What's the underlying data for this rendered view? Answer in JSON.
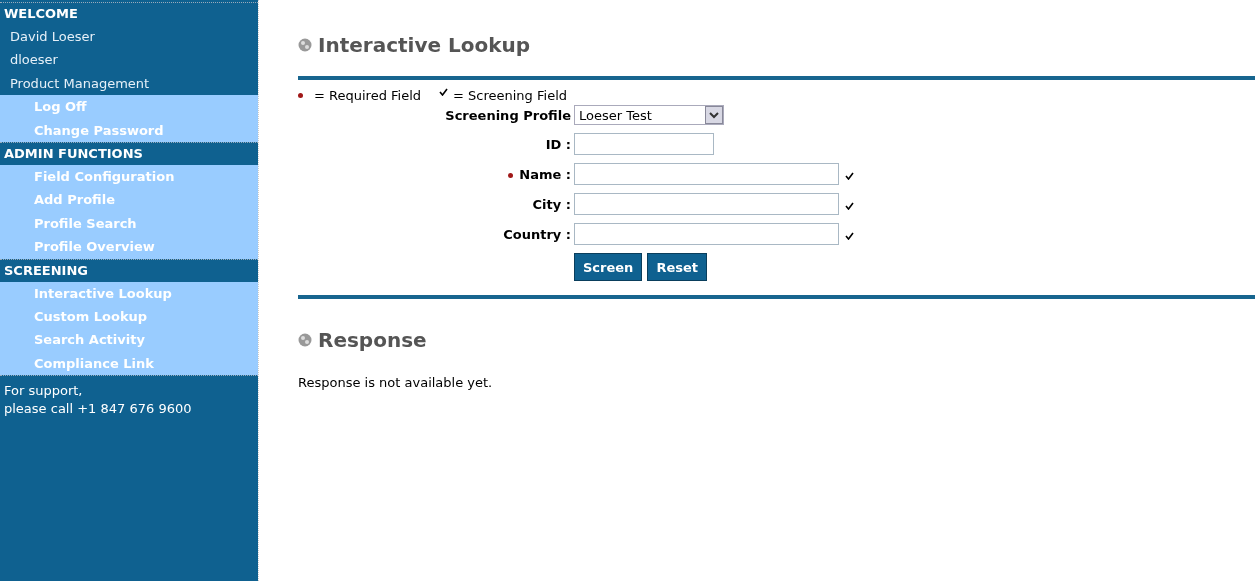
{
  "sidebar": {
    "sections": [
      {
        "heading": "WELCOME",
        "items": [
          {
            "label": "David Loeser",
            "kind": "info"
          },
          {
            "label": "dloeser",
            "kind": "info"
          },
          {
            "label": "Product Management",
            "kind": "info"
          },
          {
            "label": "Log Off",
            "kind": "link"
          },
          {
            "label": "Change Password",
            "kind": "link"
          }
        ]
      },
      {
        "heading": "ADMIN FUNCTIONS",
        "items": [
          {
            "label": "Field Configuration",
            "kind": "link"
          },
          {
            "label": "Add Profile",
            "kind": "link"
          },
          {
            "label": "Profile Search",
            "kind": "link"
          },
          {
            "label": "Profile Overview",
            "kind": "link"
          }
        ]
      },
      {
        "heading": "SCREENING",
        "items": [
          {
            "label": "Interactive Lookup",
            "kind": "link"
          },
          {
            "label": "Custom Lookup",
            "kind": "link"
          },
          {
            "label": "Search Activity",
            "kind": "link"
          },
          {
            "label": "Compliance Link",
            "kind": "link"
          }
        ]
      }
    ],
    "footer": [
      "For support,",
      "please call +1 847 676 9600"
    ]
  },
  "lookup": {
    "title": "Interactive Lookup",
    "legend": {
      "required": "= Required Field",
      "screening": "= Screening Field"
    },
    "profile": {
      "label": "Screening Profile",
      "value": "Loeser Test"
    },
    "fields": [
      {
        "label": "ID :",
        "required": false,
        "screening": false,
        "kind": "short"
      },
      {
        "label": "Name :",
        "required": true,
        "screening": true,
        "kind": "long"
      },
      {
        "label": "City :",
        "required": false,
        "screening": true,
        "kind": "long"
      },
      {
        "label": "Country :",
        "required": false,
        "screening": true,
        "kind": "long"
      }
    ],
    "buttons": [
      "Screen",
      "Reset"
    ]
  },
  "response": {
    "title": "Response",
    "message": "Response is not available yet."
  }
}
